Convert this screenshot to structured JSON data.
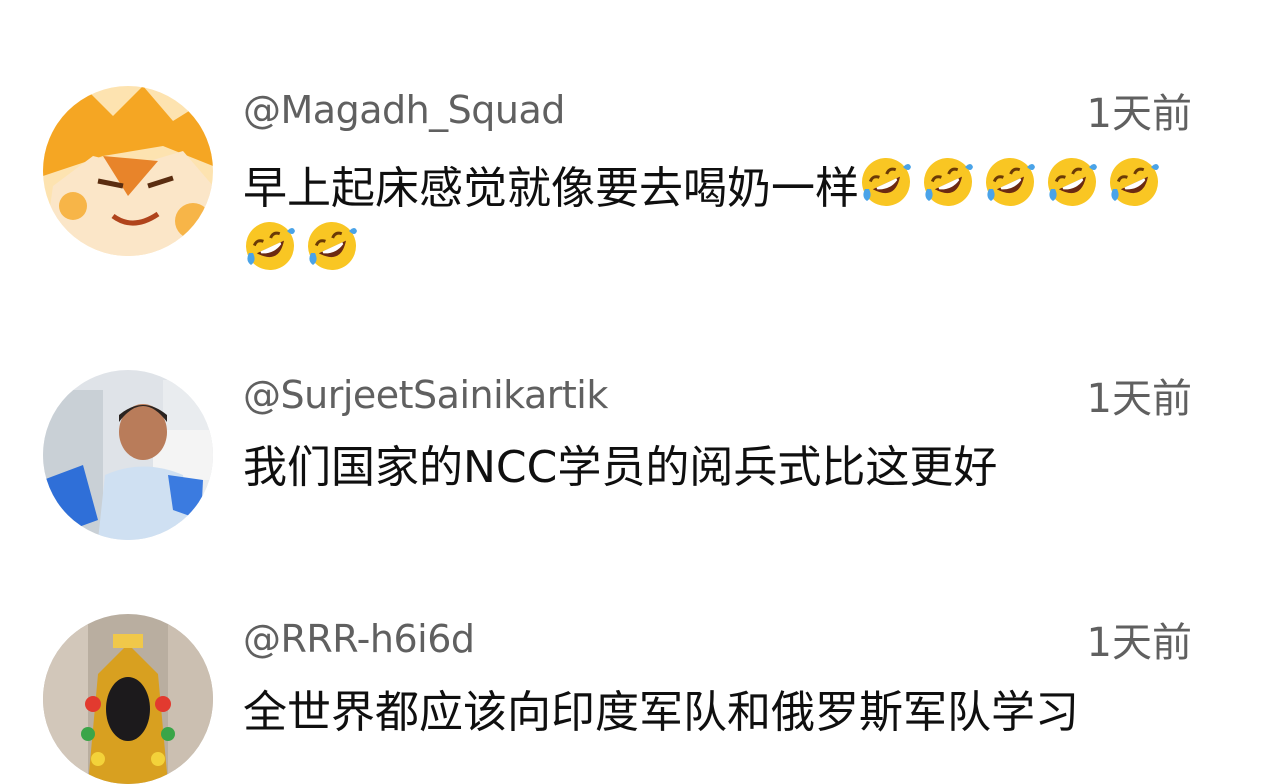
{
  "comments": [
    {
      "username": "@Magadh_Squad",
      "time": "1天前",
      "text": "早上起床感觉就像要去喝奶一样",
      "emoji": "rolling-on-the-floor-laughing",
      "emoji_count": 7
    },
    {
      "username": "@SurjeetSainikartik",
      "time": "1天前",
      "text": "我们国家的NCC学员的阅兵式比这更好"
    },
    {
      "username": "@RRR-h6i6d",
      "time": "1天前",
      "text": "全世界都应该向印度军队和俄罗斯军队学习"
    }
  ],
  "colors": {
    "meta_text": "#606060",
    "body_text": "#0f0f0f",
    "background": "#ffffff"
  }
}
